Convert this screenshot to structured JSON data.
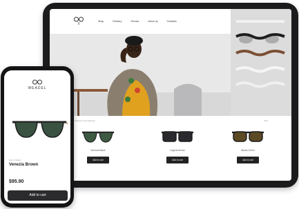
{
  "brand": {
    "logo": "op",
    "wordmark": "WEADEL"
  },
  "nav": [
    {
      "label": "Shop"
    },
    {
      "label": "Delivery"
    },
    {
      "label": "Service"
    },
    {
      "label": "About us"
    },
    {
      "label": "Contacts"
    }
  ],
  "catalog": {
    "breadcrumb": "Glasses & Sunglasses",
    "pager": "Next",
    "products": [
      {
        "name": "Venezia Black",
        "cart_label": "Add to cart"
      },
      {
        "name": "Legend Brown",
        "cart_label": "Add to cart"
      },
      {
        "name": "Nicole Green",
        "cart_label": "Add to cart"
      }
    ]
  },
  "phone": {
    "category": "Men's classic",
    "product_name": "Venezia Brown",
    "price": "$95.90",
    "cart_label": "Add to cart"
  },
  "colors": {
    "device_frame": "#1b1b1d",
    "button_dark": "#222222"
  }
}
